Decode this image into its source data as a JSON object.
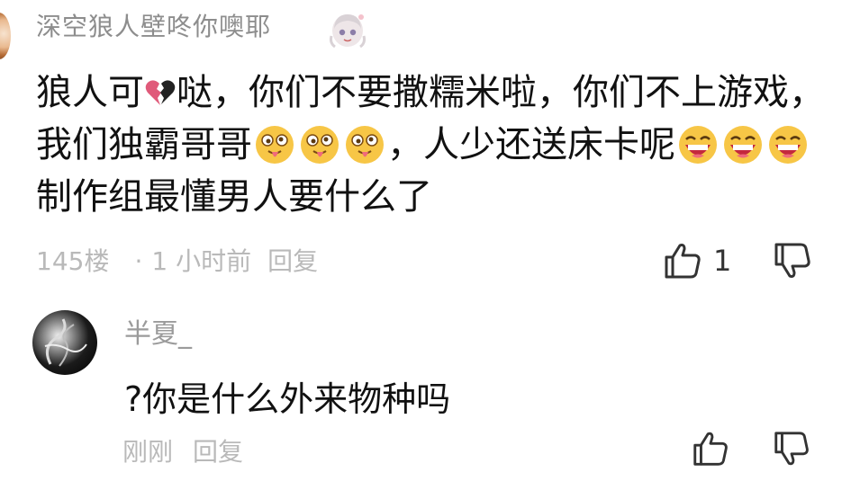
{
  "comment": {
    "username": "深空狼人壁咚你噢耶",
    "lines": [
      {
        "before": "狼人可",
        "after": "哒，你们不要撒糯米啦，你们不上游戏，"
      },
      {
        "before": "我们独霸哥哥",
        "middle": "，人少还送床卡呢",
        "after": ""
      },
      {
        "text": "制作组最懂男人要什么了"
      }
    ],
    "floor": "145楼",
    "separator": "·",
    "time": "1 小时前",
    "reply_label": "回复",
    "like_count": "1"
  },
  "reply": {
    "username": "半夏_",
    "text": "?你是什么外来物种吗",
    "time": "刚刚",
    "reply_label": "回复"
  }
}
